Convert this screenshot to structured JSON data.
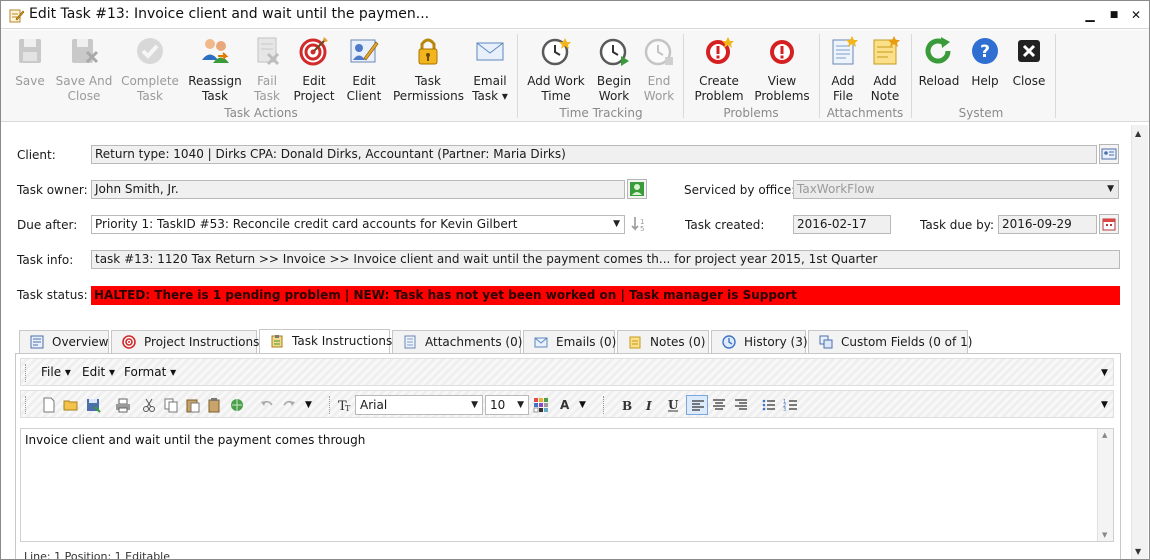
{
  "window": {
    "title": "Edit Task #13: Invoice client and wait until the paymen...",
    "controls": {
      "minimize": "▁",
      "maximize": "■",
      "close": "✕"
    }
  },
  "ribbon": {
    "groups": [
      {
        "label": "Task Actions",
        "buttons": [
          {
            "label": "Save",
            "icon": "save-icon",
            "enabled": false
          },
          {
            "label": "Save And\nClose",
            "icon": "save-close-icon",
            "enabled": false
          },
          {
            "label": "Complete\nTask",
            "icon": "check-icon",
            "enabled": false
          },
          {
            "label": "Reassign\nTask",
            "icon": "reassign-icon",
            "enabled": true
          },
          {
            "label": "Fail\nTask",
            "icon": "fail-icon",
            "enabled": false
          },
          {
            "label": "Edit\nProject",
            "icon": "target-icon",
            "enabled": true
          },
          {
            "label": "Edit\nClient",
            "icon": "edit-client-icon",
            "enabled": true
          },
          {
            "label": "Task\nPermissions",
            "icon": "lock-icon",
            "enabled": true
          },
          {
            "label": "Email\nTask ▾",
            "icon": "email-icon",
            "enabled": true
          }
        ]
      },
      {
        "label": "Time Tracking",
        "buttons": [
          {
            "label": "Add Work\nTime",
            "icon": "clock-add-icon",
            "enabled": true
          },
          {
            "label": "Begin\nWork",
            "icon": "clock-begin-icon",
            "enabled": true
          },
          {
            "label": "End\nWork",
            "icon": "clock-end-icon",
            "enabled": false
          }
        ]
      },
      {
        "label": "Problems",
        "buttons": [
          {
            "label": "Create\nProblem",
            "icon": "create-problem-icon",
            "enabled": true
          },
          {
            "label": "View\nProblems",
            "icon": "view-problems-icon",
            "enabled": true
          }
        ]
      },
      {
        "label": "Attachments",
        "buttons": [
          {
            "label": "Add\nFile",
            "icon": "add-file-icon",
            "enabled": true
          },
          {
            "label": "Add\nNote",
            "icon": "add-note-icon",
            "enabled": true
          }
        ]
      },
      {
        "label": "System",
        "buttons": [
          {
            "label": "Reload",
            "icon": "reload-icon",
            "enabled": true
          },
          {
            "label": "Help",
            "icon": "help-icon",
            "enabled": true
          },
          {
            "label": "Close",
            "icon": "close-icon",
            "enabled": true
          }
        ]
      }
    ]
  },
  "form": {
    "client_label": "Client:",
    "client_value": "Return type: 1040 | Dirks CPA: Donald Dirks, Accountant (Partner: Maria Dirks)",
    "owner_label": "Task owner:",
    "owner_value": "John Smith, Jr.",
    "serviced_label": "Serviced by office:",
    "serviced_value": "TaxWorkFlow",
    "due_after_label": "Due after:",
    "due_after_value": "Priority 1: TaskID #53: Reconcile credit card accounts for Kevin Gilbert",
    "created_label": "Task created:",
    "created_value": "2016-02-17",
    "due_by_label": "Task due by:",
    "due_by_value": "2016-09-29",
    "info_label": "Task info:",
    "info_value": "task #13: 1120 Tax Return >> Invoice >> Invoice client and wait until the payment comes th... for project year 2015, 1st Quarter",
    "status_label": "Task status:",
    "status_value": "HALTED: There is 1 pending problem | NEW: Task has not yet been worked on | Task manager is Support",
    "status_color": "#ff0000"
  },
  "tabs": [
    {
      "label": "Overview",
      "icon": "overview-icon",
      "active": false
    },
    {
      "label": "Project Instructions",
      "icon": "target-icon",
      "active": false
    },
    {
      "label": "Task Instructions",
      "icon": "clipboard-icon",
      "active": true
    },
    {
      "label": "Attachments (0)",
      "icon": "attachments-icon",
      "active": false
    },
    {
      "label": "Emails (0)",
      "icon": "emails-icon",
      "active": false
    },
    {
      "label": "Notes (0)",
      "icon": "notes-icon",
      "active": false
    },
    {
      "label": "History (3)",
      "icon": "history-icon",
      "active": false
    },
    {
      "label": "Custom Fields (0 of 1)",
      "icon": "custom-fields-icon",
      "active": false
    }
  ],
  "editor": {
    "menus": [
      "File ▾",
      "Edit ▾",
      "Format ▾"
    ],
    "font_name": "Arial",
    "font_size": "10",
    "text": "Invoice client and wait until the payment comes through",
    "status": "Line: 1   Position: 1   Editable"
  }
}
